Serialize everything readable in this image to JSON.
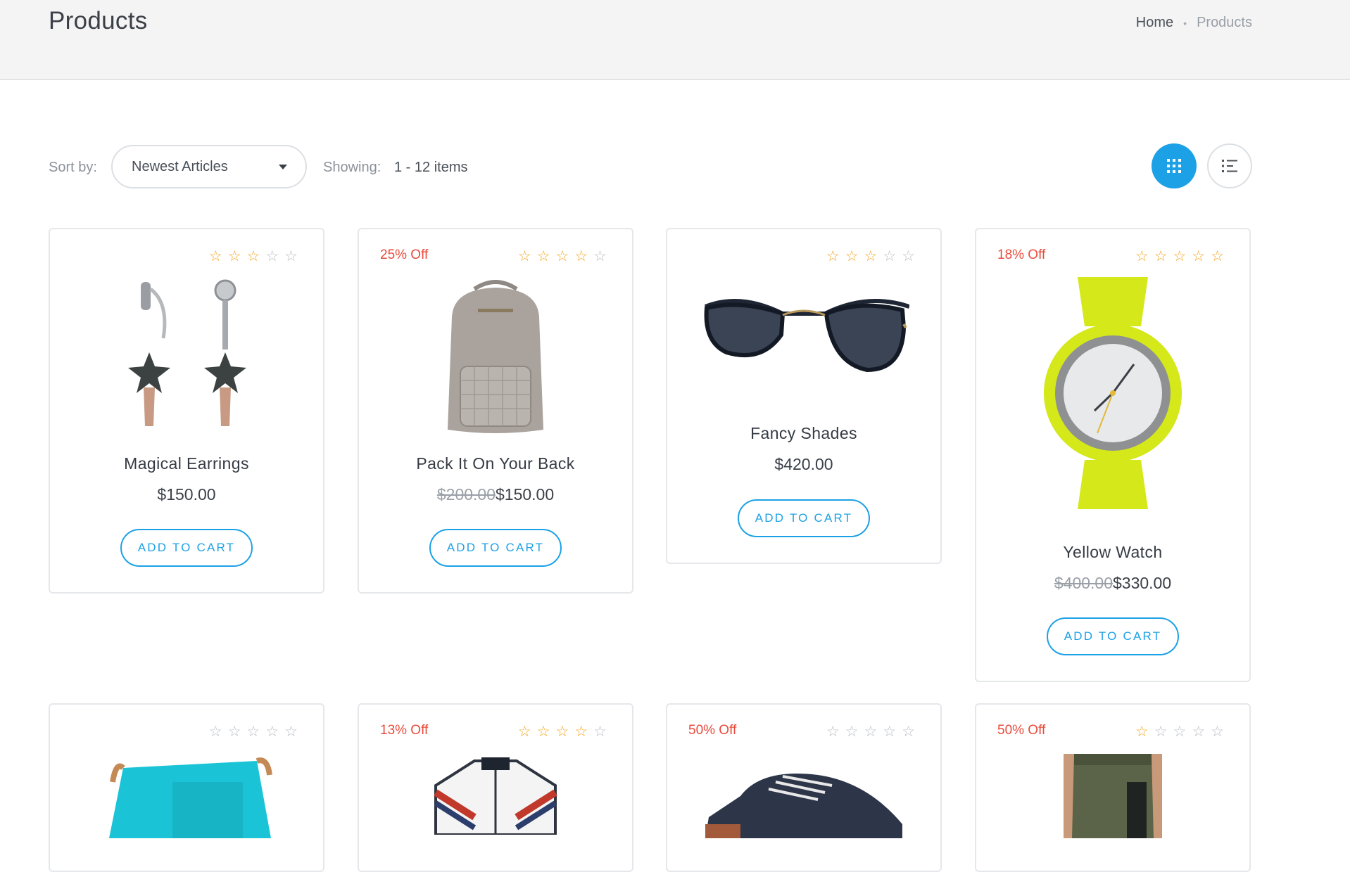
{
  "header": {
    "title": "Products",
    "breadcrumb": {
      "home": "Home",
      "separator": "•",
      "current": "Products"
    }
  },
  "toolbar": {
    "sort_label": "Sort by:",
    "sort_value": "Newest Articles",
    "showing_label": "Showing:",
    "showing_value": "1 - 12 items",
    "grid_view_icon": "grid-icon",
    "list_view_icon": "list-icon",
    "active_view": "grid"
  },
  "colors": {
    "accent": "#1da1e6",
    "badge": "#e94b3c",
    "star": "#f5a623"
  },
  "products": [
    {
      "name": "Magical Earrings",
      "badge": "",
      "rating": 3,
      "old_price": "",
      "price": "$150.00",
      "button": "ADD TO CART"
    },
    {
      "name": "Pack It On Your Back",
      "badge": "25% Off",
      "rating": 4,
      "old_price": "$200.00",
      "price": "$150.00",
      "button": "ADD TO CART"
    },
    {
      "name": "Fancy Shades",
      "badge": "",
      "rating": 3,
      "old_price": "",
      "price": "$420.00",
      "button": "ADD TO CART"
    },
    {
      "name": "Yellow Watch",
      "badge": "18% Off",
      "rating": 5,
      "old_price": "$400.00",
      "price": "$330.00",
      "button": "ADD TO CART"
    },
    {
      "name": "",
      "badge": "",
      "rating": 0,
      "old_price": "",
      "price": "",
      "button": ""
    },
    {
      "name": "",
      "badge": "13% Off",
      "rating": 4,
      "old_price": "",
      "price": "",
      "button": ""
    },
    {
      "name": "",
      "badge": "50% Off",
      "rating": 0,
      "old_price": "",
      "price": "",
      "button": ""
    },
    {
      "name": "",
      "badge": "50% Off",
      "rating": 1,
      "old_price": "",
      "price": "",
      "button": ""
    }
  ]
}
